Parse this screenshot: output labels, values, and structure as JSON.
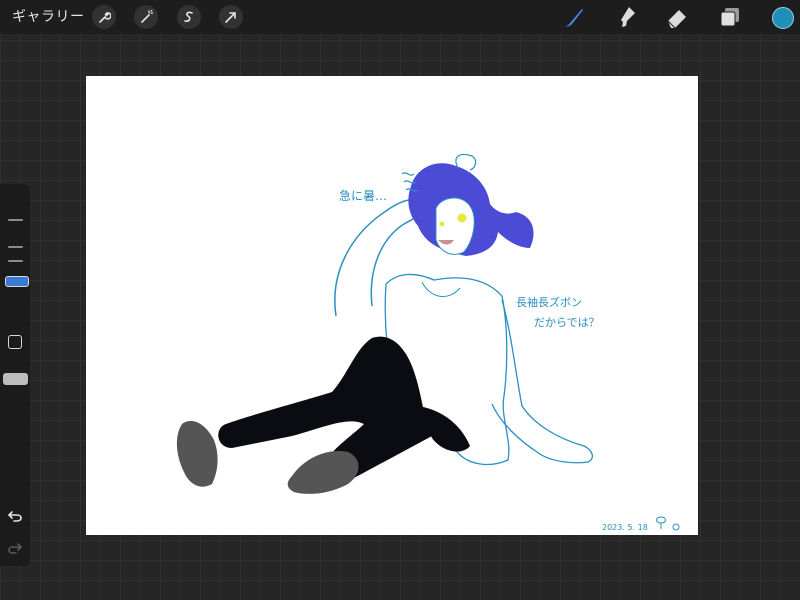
{
  "toolbar": {
    "gallery_label": "ギャラリー",
    "left_tools": [
      "wrench-icon",
      "magic-wand-icon",
      "selection-icon",
      "transform-arrow-icon"
    ],
    "right_tools": [
      "brush-icon",
      "smudge-icon",
      "eraser-icon",
      "layers-icon"
    ],
    "active_tool": "brush-icon",
    "current_color": "#1f8fb8",
    "active_tool_color": "#3a8ef0"
  },
  "sidebar": {
    "brush_size_label": "brush-size-slider",
    "modify_label": "modify-button",
    "opacity_label": "opacity-slider",
    "undo_icon": "undo-icon",
    "redo_icon": "redo-icon"
  },
  "artwork": {
    "speech_left": "急に暑…",
    "speech_right_line1": "長袖長ズボン",
    "speech_right_line2": "だからでは？",
    "date": "2023. 5. 18",
    "hair_color": "#4b4bd6",
    "line_color": "#2a8fc2",
    "pants_color": "#0b0b12",
    "shoe_color": "#555555"
  }
}
